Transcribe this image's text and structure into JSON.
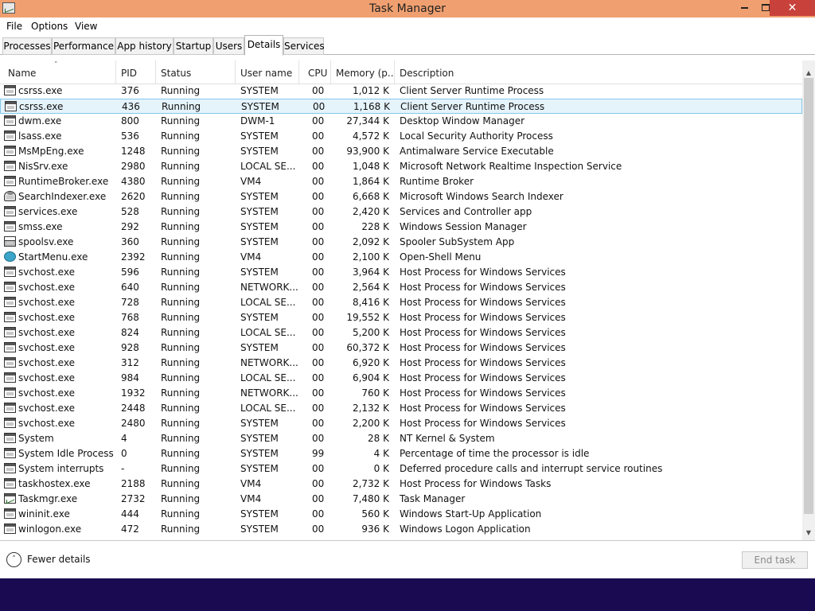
{
  "window": {
    "title": "Task Manager",
    "close_glyph": "✕"
  },
  "menu": [
    "File",
    "Options",
    "View"
  ],
  "tabs": [
    "Processes",
    "Performance",
    "App history",
    "Startup",
    "Users",
    "Details",
    "Services"
  ],
  "active_tab": "Details",
  "columns": [
    "Name",
    "PID",
    "Status",
    "User name",
    "CPU",
    "Memory (p...",
    "Description"
  ],
  "sort_indicator": "˄",
  "selected_row": 1,
  "processes": [
    {
      "name": "csrss.exe",
      "pid": "376",
      "status": "Running",
      "user": "SYSTEM",
      "cpu": "00",
      "memory": "1,012 K",
      "description": "Client Server Runtime Process",
      "icon": "generic-icon"
    },
    {
      "name": "csrss.exe",
      "pid": "436",
      "status": "Running",
      "user": "SYSTEM",
      "cpu": "00",
      "memory": "1,168 K",
      "description": "Client Server Runtime Process",
      "icon": "generic-icon"
    },
    {
      "name": "dwm.exe",
      "pid": "800",
      "status": "Running",
      "user": "DWM-1",
      "cpu": "00",
      "memory": "27,344 K",
      "description": "Desktop Window Manager",
      "icon": "generic-icon"
    },
    {
      "name": "lsass.exe",
      "pid": "536",
      "status": "Running",
      "user": "SYSTEM",
      "cpu": "00",
      "memory": "4,572 K",
      "description": "Local Security Authority Process",
      "icon": "generic-icon"
    },
    {
      "name": "MsMpEng.exe",
      "pid": "1248",
      "status": "Running",
      "user": "SYSTEM",
      "cpu": "00",
      "memory": "93,900 K",
      "description": "Antimalware Service Executable",
      "icon": "generic-icon"
    },
    {
      "name": "NisSrv.exe",
      "pid": "2980",
      "status": "Running",
      "user": "LOCAL SE...",
      "cpu": "00",
      "memory": "1,048 K",
      "description": "Microsoft Network Realtime Inspection Service",
      "icon": "generic-icon"
    },
    {
      "name": "RuntimeBroker.exe",
      "pid": "4380",
      "status": "Running",
      "user": "VM4",
      "cpu": "00",
      "memory": "1,864 K",
      "description": "Runtime Broker",
      "icon": "generic-icon"
    },
    {
      "name": "SearchIndexer.exe",
      "pid": "2620",
      "status": "Running",
      "user": "SYSTEM",
      "cpu": "00",
      "memory": "6,668 K",
      "description": "Microsoft Windows Search Indexer",
      "icon": "search-indexer-icon"
    },
    {
      "name": "services.exe",
      "pid": "528",
      "status": "Running",
      "user": "SYSTEM",
      "cpu": "00",
      "memory": "2,420 K",
      "description": "Services and Controller app",
      "icon": "generic-icon"
    },
    {
      "name": "smss.exe",
      "pid": "292",
      "status": "Running",
      "user": "SYSTEM",
      "cpu": "00",
      "memory": "228 K",
      "description": "Windows Session Manager",
      "icon": "generic-icon"
    },
    {
      "name": "spoolsv.exe",
      "pid": "360",
      "status": "Running",
      "user": "SYSTEM",
      "cpu": "00",
      "memory": "2,092 K",
      "description": "Spooler SubSystem App",
      "icon": "printer-icon"
    },
    {
      "name": "StartMenu.exe",
      "pid": "2392",
      "status": "Running",
      "user": "VM4",
      "cpu": "00",
      "memory": "2,100 K",
      "description": "Open-Shell Menu",
      "icon": "start-menu-icon"
    },
    {
      "name": "svchost.exe",
      "pid": "596",
      "status": "Running",
      "user": "SYSTEM",
      "cpu": "00",
      "memory": "3,964 K",
      "description": "Host Process for Windows Services",
      "icon": "generic-icon"
    },
    {
      "name": "svchost.exe",
      "pid": "640",
      "status": "Running",
      "user": "NETWORK...",
      "cpu": "00",
      "memory": "2,564 K",
      "description": "Host Process for Windows Services",
      "icon": "generic-icon"
    },
    {
      "name": "svchost.exe",
      "pid": "728",
      "status": "Running",
      "user": "LOCAL SE...",
      "cpu": "00",
      "memory": "8,416 K",
      "description": "Host Process for Windows Services",
      "icon": "generic-icon"
    },
    {
      "name": "svchost.exe",
      "pid": "768",
      "status": "Running",
      "user": "SYSTEM",
      "cpu": "00",
      "memory": "19,552 K",
      "description": "Host Process for Windows Services",
      "icon": "generic-icon"
    },
    {
      "name": "svchost.exe",
      "pid": "824",
      "status": "Running",
      "user": "LOCAL SE...",
      "cpu": "00",
      "memory": "5,200 K",
      "description": "Host Process for Windows Services",
      "icon": "generic-icon"
    },
    {
      "name": "svchost.exe",
      "pid": "928",
      "status": "Running",
      "user": "SYSTEM",
      "cpu": "00",
      "memory": "60,372 K",
      "description": "Host Process for Windows Services",
      "icon": "generic-icon"
    },
    {
      "name": "svchost.exe",
      "pid": "312",
      "status": "Running",
      "user": "NETWORK...",
      "cpu": "00",
      "memory": "6,920 K",
      "description": "Host Process for Windows Services",
      "icon": "generic-icon"
    },
    {
      "name": "svchost.exe",
      "pid": "984",
      "status": "Running",
      "user": "LOCAL SE...",
      "cpu": "00",
      "memory": "6,904 K",
      "description": "Host Process for Windows Services",
      "icon": "generic-icon"
    },
    {
      "name": "svchost.exe",
      "pid": "1932",
      "status": "Running",
      "user": "NETWORK...",
      "cpu": "00",
      "memory": "760 K",
      "description": "Host Process for Windows Services",
      "icon": "generic-icon"
    },
    {
      "name": "svchost.exe",
      "pid": "2448",
      "status": "Running",
      "user": "LOCAL SE...",
      "cpu": "00",
      "memory": "2,132 K",
      "description": "Host Process for Windows Services",
      "icon": "generic-icon"
    },
    {
      "name": "svchost.exe",
      "pid": "2480",
      "status": "Running",
      "user": "SYSTEM",
      "cpu": "00",
      "memory": "2,200 K",
      "description": "Host Process for Windows Services",
      "icon": "generic-icon"
    },
    {
      "name": "System",
      "pid": "4",
      "status": "Running",
      "user": "SYSTEM",
      "cpu": "00",
      "memory": "28 K",
      "description": "NT Kernel & System",
      "icon": "generic-icon"
    },
    {
      "name": "System Idle Process",
      "pid": "0",
      "status": "Running",
      "user": "SYSTEM",
      "cpu": "99",
      "memory": "4 K",
      "description": "Percentage of time the processor is idle",
      "icon": "generic-icon"
    },
    {
      "name": "System interrupts",
      "pid": "-",
      "status": "Running",
      "user": "SYSTEM",
      "cpu": "00",
      "memory": "0 K",
      "description": "Deferred procedure calls and interrupt service routines",
      "icon": "generic-icon"
    },
    {
      "name": "taskhostex.exe",
      "pid": "2188",
      "status": "Running",
      "user": "VM4",
      "cpu": "00",
      "memory": "2,732 K",
      "description": "Host Process for Windows Tasks",
      "icon": "generic-icon"
    },
    {
      "name": "Taskmgr.exe",
      "pid": "2732",
      "status": "Running",
      "user": "VM4",
      "cpu": "00",
      "memory": "7,480 K",
      "description": "Task Manager",
      "icon": "task-manager-icon"
    },
    {
      "name": "wininit.exe",
      "pid": "444",
      "status": "Running",
      "user": "SYSTEM",
      "cpu": "00",
      "memory": "560 K",
      "description": "Windows Start-Up Application",
      "icon": "generic-icon"
    },
    {
      "name": "winlogon.exe",
      "pid": "472",
      "status": "Running",
      "user": "SYSTEM",
      "cpu": "00",
      "memory": "936 K",
      "description": "Windows Logon Application",
      "icon": "generic-icon"
    }
  ],
  "footer": {
    "fewer_details": "Fewer details",
    "end_task": "End task"
  },
  "colors": {
    "titlebar": "#f0a070",
    "close_button": "#c8413a",
    "selection": "#e5f3fb",
    "selection_border": "#84c8eb",
    "desktop": "#1a0a52"
  }
}
